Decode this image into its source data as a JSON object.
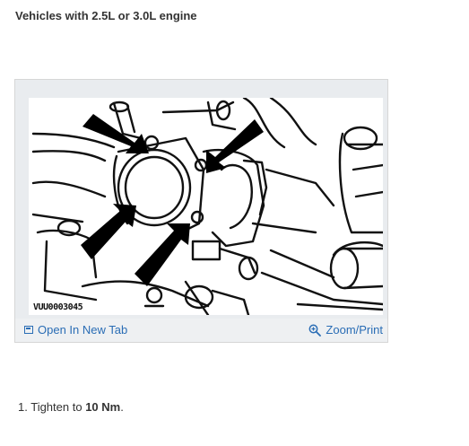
{
  "heading": "Vehicles with 2.5L or 3.0L engine",
  "figure": {
    "code": "VUU0003045",
    "open_tab_label": "Open In New Tab",
    "zoom_label": "Zoom/Print",
    "link_color": "#2a6db5",
    "toolbar_color": "#eef0f2"
  },
  "instructions": [
    {
      "number": "1.",
      "prefix": "Tighten to",
      "value": "10 Nm",
      "suffix": "."
    }
  ]
}
